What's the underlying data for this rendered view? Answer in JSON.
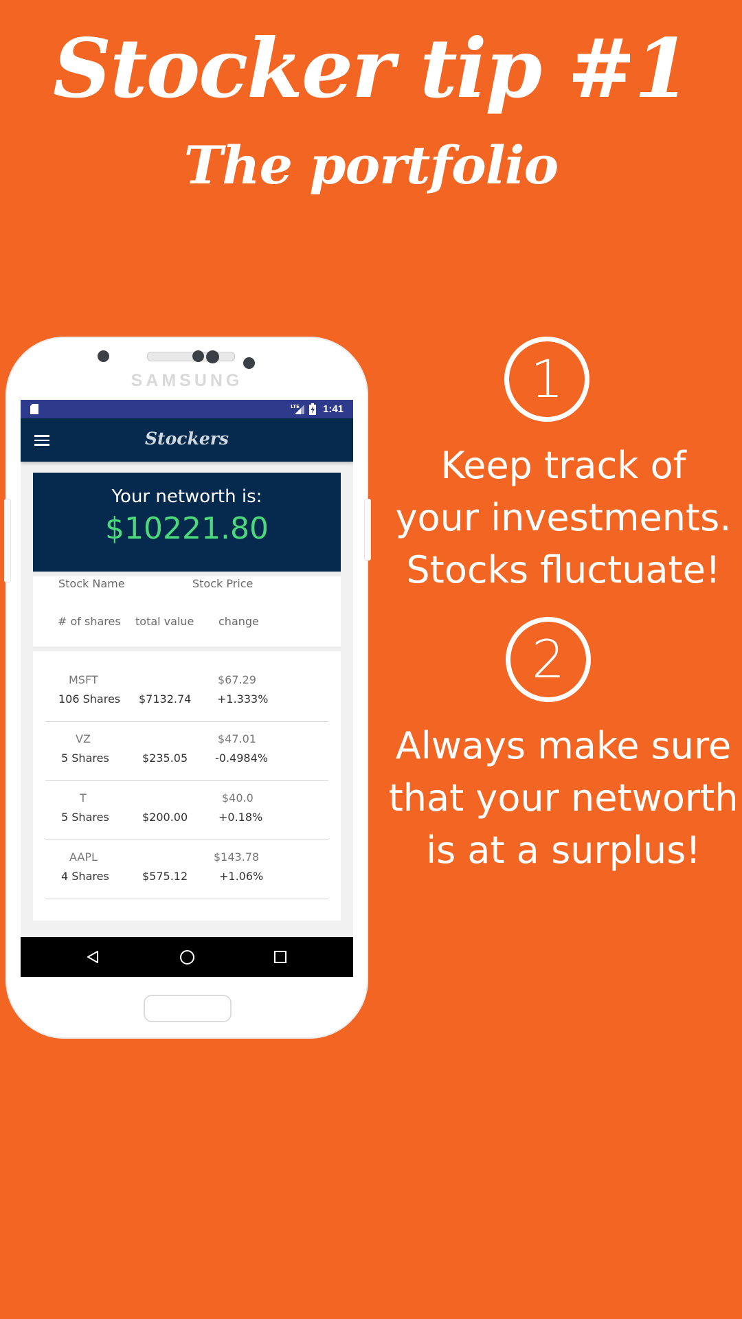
{
  "page": {
    "title": "Stocker tip #1",
    "subtitle": "The portfolio"
  },
  "phone": {
    "brand": "SAMSUNG",
    "status_bar": {
      "time": "1:41",
      "network": "LTE"
    },
    "app_bar": {
      "title": "Stockers",
      "menu_icon": "hamburger-menu-icon"
    },
    "networth": {
      "label": "Your networth is:",
      "value": "$10221.80"
    },
    "table_headers": {
      "stock_name": "Stock Name",
      "stock_price": "Stock Price",
      "num_shares": "# of shares",
      "total_value": "total value",
      "change": "change"
    },
    "stocks": [
      {
        "symbol": "MSFT",
        "price": "$67.29",
        "shares": "106 Shares",
        "total": "$7132.74",
        "change": "+1.333%"
      },
      {
        "symbol": "VZ",
        "price": "$47.01",
        "shares": "5 Shares",
        "total": "$235.05",
        "change": "-0.4984%"
      },
      {
        "symbol": "T",
        "price": "$40.0",
        "shares": "5 Shares",
        "total": "$200.00",
        "change": "+0.18%"
      },
      {
        "symbol": "AAPL",
        "price": "$143.78",
        "shares": "4 Shares",
        "total": "$575.12",
        "change": "+1.06%"
      }
    ],
    "nav_bar": {
      "back_icon": "back-triangle-icon",
      "home_icon": "home-circle-icon",
      "recent_icon": "recent-apps-square-icon"
    }
  },
  "tips": [
    {
      "number": "1",
      "lines": [
        "Keep track of",
        "your investments.",
        "Stocks fluctuate!"
      ]
    },
    {
      "number": "2",
      "lines": [
        "Always make sure",
        "that your networth",
        "is at a surplus!"
      ]
    }
  ],
  "colors": {
    "background": "#F26522",
    "status_bar": "#2E3A8C",
    "app_bar": "#062A4E",
    "networth_value": "#4CD97B"
  }
}
